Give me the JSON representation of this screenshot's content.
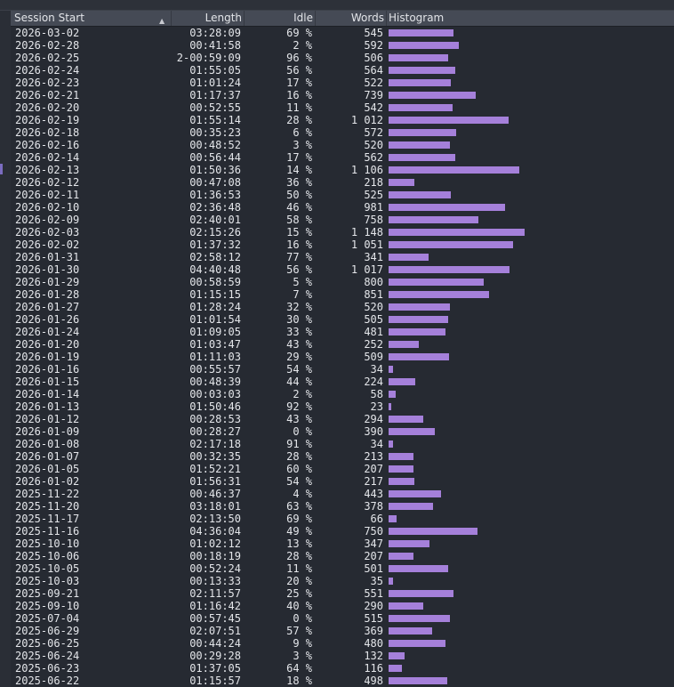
{
  "table": {
    "columns": {
      "session_start": "Session Start",
      "length": "Length",
      "idle": "Idle",
      "words": "Words",
      "histogram": "Histogram"
    },
    "sort_icon": "sort-ascending-icon",
    "bar_color": "#a580da",
    "rows": [
      {
        "start": "2026-03-02",
        "length": "03:28:09",
        "idle": "69 %",
        "words": "545",
        "value": 545
      },
      {
        "start": "2026-02-28",
        "length": "00:41:58",
        "idle": "2 %",
        "words": "592",
        "value": 592
      },
      {
        "start": "2026-02-25",
        "length": "2-00:59:09",
        "idle": "96 %",
        "words": "506",
        "value": 506
      },
      {
        "start": "2026-02-24",
        "length": "01:55:05",
        "idle": "56 %",
        "words": "564",
        "value": 564
      },
      {
        "start": "2026-02-23",
        "length": "01:01:24",
        "idle": "17 %",
        "words": "522",
        "value": 522
      },
      {
        "start": "2026-02-21",
        "length": "01:17:37",
        "idle": "16 %",
        "words": "739",
        "value": 739
      },
      {
        "start": "2026-02-20",
        "length": "00:52:55",
        "idle": "11 %",
        "words": "542",
        "value": 542
      },
      {
        "start": "2026-02-19",
        "length": "01:55:14",
        "idle": "28 %",
        "words": "1 012",
        "value": 1012
      },
      {
        "start": "2026-02-18",
        "length": "00:35:23",
        "idle": "6 %",
        "words": "572",
        "value": 572
      },
      {
        "start": "2026-02-16",
        "length": "00:48:52",
        "idle": "3 %",
        "words": "520",
        "value": 520
      },
      {
        "start": "2026-02-14",
        "length": "00:56:44",
        "idle": "17 %",
        "words": "562",
        "value": 562
      },
      {
        "start": "2026-02-13",
        "length": "01:50:36",
        "idle": "14 %",
        "words": "1 106",
        "value": 1106
      },
      {
        "start": "2026-02-12",
        "length": "00:47:08",
        "idle": "36 %",
        "words": "218",
        "value": 218
      },
      {
        "start": "2026-02-11",
        "length": "01:36:53",
        "idle": "50 %",
        "words": "525",
        "value": 525
      },
      {
        "start": "2026-02-10",
        "length": "02:36:48",
        "idle": "46 %",
        "words": "981",
        "value": 981
      },
      {
        "start": "2026-02-09",
        "length": "02:40:01",
        "idle": "58 %",
        "words": "758",
        "value": 758
      },
      {
        "start": "2026-02-03",
        "length": "02:15:26",
        "idle": "15 %",
        "words": "1 148",
        "value": 1148
      },
      {
        "start": "2026-02-02",
        "length": "01:37:32",
        "idle": "16 %",
        "words": "1 051",
        "value": 1051
      },
      {
        "start": "2026-01-31",
        "length": "02:58:12",
        "idle": "77 %",
        "words": "341",
        "value": 341
      },
      {
        "start": "2026-01-30",
        "length": "04:40:48",
        "idle": "56 %",
        "words": "1 017",
        "value": 1017
      },
      {
        "start": "2026-01-29",
        "length": "00:58:59",
        "idle": "5 %",
        "words": "800",
        "value": 800
      },
      {
        "start": "2026-01-28",
        "length": "01:15:15",
        "idle": "7 %",
        "words": "851",
        "value": 851
      },
      {
        "start": "2026-01-27",
        "length": "01:28:24",
        "idle": "32 %",
        "words": "520",
        "value": 520
      },
      {
        "start": "2026-01-26",
        "length": "01:01:54",
        "idle": "30 %",
        "words": "505",
        "value": 505
      },
      {
        "start": "2026-01-24",
        "length": "01:09:05",
        "idle": "33 %",
        "words": "481",
        "value": 481
      },
      {
        "start": "2026-01-20",
        "length": "01:03:47",
        "idle": "43 %",
        "words": "252",
        "value": 252
      },
      {
        "start": "2026-01-19",
        "length": "01:11:03",
        "idle": "29 %",
        "words": "509",
        "value": 509
      },
      {
        "start": "2026-01-16",
        "length": "00:55:57",
        "idle": "54 %",
        "words": "34",
        "value": 34
      },
      {
        "start": "2026-01-15",
        "length": "00:48:39",
        "idle": "44 %",
        "words": "224",
        "value": 224
      },
      {
        "start": "2026-01-14",
        "length": "00:03:03",
        "idle": "2 %",
        "words": "58",
        "value": 58
      },
      {
        "start": "2026-01-13",
        "length": "01:50:46",
        "idle": "92 %",
        "words": "23",
        "value": 23
      },
      {
        "start": "2026-01-12",
        "length": "00:28:53",
        "idle": "43 %",
        "words": "294",
        "value": 294
      },
      {
        "start": "2026-01-09",
        "length": "00:28:27",
        "idle": "0 %",
        "words": "390",
        "value": 390
      },
      {
        "start": "2026-01-08",
        "length": "02:17:18",
        "idle": "91 %",
        "words": "34",
        "value": 34
      },
      {
        "start": "2026-01-07",
        "length": "00:32:35",
        "idle": "28 %",
        "words": "213",
        "value": 213
      },
      {
        "start": "2026-01-05",
        "length": "01:52:21",
        "idle": "60 %",
        "words": "207",
        "value": 207
      },
      {
        "start": "2026-01-02",
        "length": "01:56:31",
        "idle": "54 %",
        "words": "217",
        "value": 217
      },
      {
        "start": "2025-11-22",
        "length": "00:46:37",
        "idle": "4 %",
        "words": "443",
        "value": 443
      },
      {
        "start": "2025-11-20",
        "length": "03:18:01",
        "idle": "63 %",
        "words": "378",
        "value": 378
      },
      {
        "start": "2025-11-17",
        "length": "02:13:50",
        "idle": "69 %",
        "words": "66",
        "value": 66
      },
      {
        "start": "2025-11-16",
        "length": "04:36:04",
        "idle": "49 %",
        "words": "750",
        "value": 750
      },
      {
        "start": "2025-10-10",
        "length": "01:02:12",
        "idle": "13 %",
        "words": "347",
        "value": 347
      },
      {
        "start": "2025-10-06",
        "length": "00:18:19",
        "idle": "28 %",
        "words": "207",
        "value": 207
      },
      {
        "start": "2025-10-05",
        "length": "00:52:24",
        "idle": "11 %",
        "words": "501",
        "value": 501
      },
      {
        "start": "2025-10-03",
        "length": "00:13:33",
        "idle": "20 %",
        "words": "35",
        "value": 35
      },
      {
        "start": "2025-09-21",
        "length": "02:11:57",
        "idle": "25 %",
        "words": "551",
        "value": 551
      },
      {
        "start": "2025-09-10",
        "length": "01:16:42",
        "idle": "40 %",
        "words": "290",
        "value": 290
      },
      {
        "start": "2025-07-04",
        "length": "00:57:45",
        "idle": "0 %",
        "words": "515",
        "value": 515
      },
      {
        "start": "2025-06-29",
        "length": "02:07:51",
        "idle": "57 %",
        "words": "369",
        "value": 369
      },
      {
        "start": "2025-06-25",
        "length": "00:44:24",
        "idle": "9 %",
        "words": "480",
        "value": 480
      },
      {
        "start": "2025-06-24",
        "length": "00:29:28",
        "idle": "3 %",
        "words": "132",
        "value": 132
      },
      {
        "start": "2025-06-23",
        "length": "01:37:05",
        "idle": "64 %",
        "words": "116",
        "value": 116
      },
      {
        "start": "2025-06-22",
        "length": "01:15:57",
        "idle": "18 %",
        "words": "498",
        "value": 498
      }
    ]
  }
}
